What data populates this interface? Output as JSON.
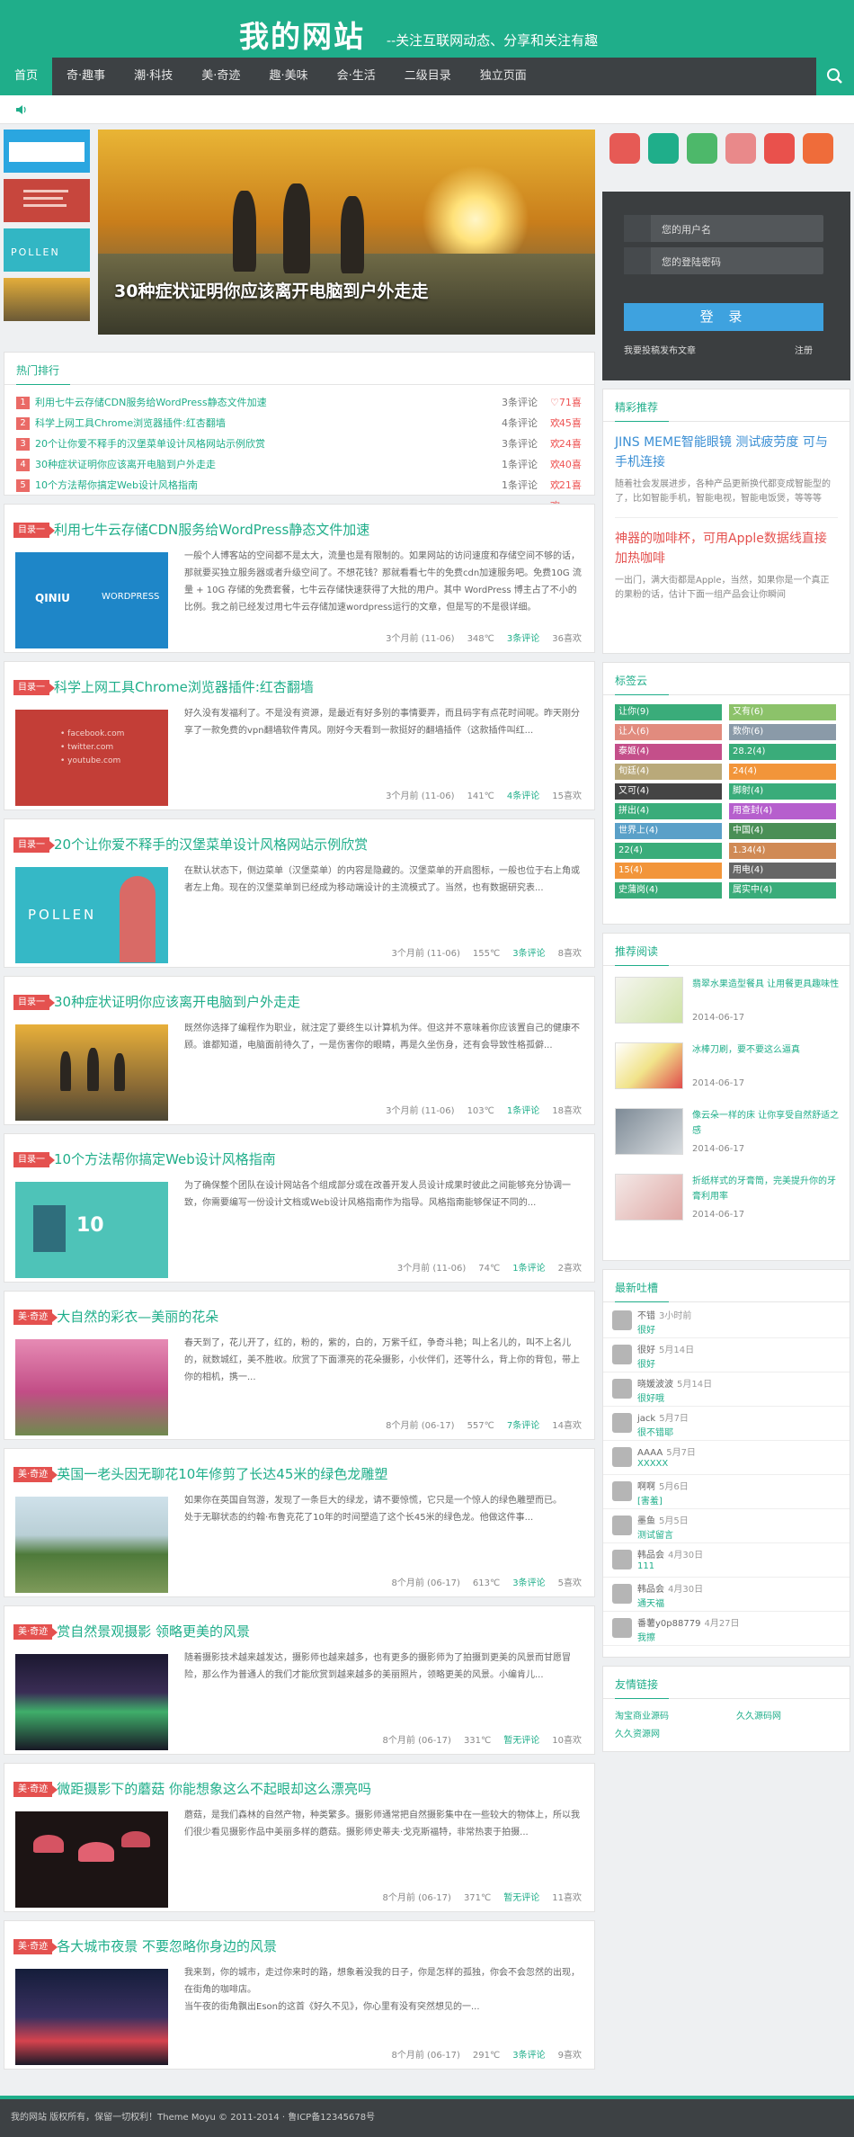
{
  "header": {
    "logo": "我的网站",
    "slogan": "--关注互联网动态、分享和关注有趣"
  },
  "nav": {
    "items": [
      "首页",
      "奇·趣事",
      "潮·科技",
      "美·奇迹",
      "趣·美味",
      "会·生活",
      "二级目录",
      "独立页面"
    ]
  },
  "slider": {
    "caption": "30种症状证明你应该离开电脑到户外走走"
  },
  "hot": {
    "title": "热门排行",
    "items": [
      {
        "num": "1",
        "title": "利用七牛云存储CDN服务给WordPress静态文件加速",
        "comments": "3条评论",
        "likes": "♡71喜欢"
      },
      {
        "num": "2",
        "title": "科学上网工具Chrome浏览器插件:红杏翻墙",
        "comments": "4条评论",
        "likes": "♡45喜欢"
      },
      {
        "num": "3",
        "title": "20个让你爱不释手的汉堡菜单设计风格网站示例欣赏",
        "comments": "3条评论",
        "likes": "♡24喜欢"
      },
      {
        "num": "4",
        "title": "30种症状证明你应该离开电脑到户外走走",
        "comments": "1条评论",
        "likes": "♡40喜欢"
      },
      {
        "num": "5",
        "title": "10个方法帮你搞定Web设计风格指南",
        "comments": "1条评论",
        "likes": "♡21喜欢"
      }
    ]
  },
  "posts": [
    {
      "badge": "目录一",
      "title": "利用七牛云存储CDN服务给WordPress静态文件加速",
      "excerpt": "一般个人博客站的空间都不是太大，流量也是有限制的。如果网站的访问速度和存储空间不够的话，那就要买独立服务器或者升级空间了。不想花钱？那就看看七牛的免费cdn加速服务吧。免费10G 流量 + 10G 存储的免费套餐，七牛云存储快速获得了大批的用户。其中 WordPress 博主占了不小的比例。我之前已经发过用七牛云存储加速wordpress运行的文章，但是写的不是很详细。",
      "time": "3个月前 (11-06)",
      "views": "348℃",
      "comments": "3条评论",
      "likes": "36喜欢"
    },
    {
      "badge": "目录一",
      "title": "科学上网工具Chrome浏览器插件:红杏翻墙",
      "excerpt": "好久没有发福利了。不是没有资源，是最近有好多别的事情要弄，而且码字有点花时间呢。昨天刚分享了一款免费的vpn翻墙软件青风。刚好今天看到一款挺好的翻墙插件（这款插件叫红...",
      "time": "3个月前 (11-06)",
      "views": "141℃",
      "comments": "4条评论",
      "likes": "15喜欢"
    },
    {
      "badge": "目录一",
      "title": "20个让你爱不释手的汉堡菜单设计风格网站示例欣赏",
      "excerpt": "在默认状态下，侧边菜单（汉堡菜单）的内容是隐藏的。汉堡菜单的开启图标，一般也位于右上角或者左上角。现在的汉堡菜单到已经成为移动端设计的主流模式了。当然，也有数据研究表...",
      "time": "3个月前 (11-06)",
      "views": "155℃",
      "comments": "3条评论",
      "likes": "8喜欢"
    },
    {
      "badge": "目录一",
      "title": "30种症状证明你应该离开电脑到户外走走",
      "excerpt": "既然你选择了编程作为职业，就注定了要终生以计算机为伴。但这并不意味着你应该置自己的健康不顾。谁都知道，电脑面前待久了，一是伤害你的眼睛，再是久坐伤身，还有会导致性格孤僻...",
      "time": "3个月前 (11-06)",
      "views": "103℃",
      "comments": "1条评论",
      "likes": "18喜欢"
    },
    {
      "badge": "目录一",
      "title": "10个方法帮你搞定Web设计风格指南",
      "excerpt": "为了确保整个团队在设计网站各个组成部分或在改善开发人员设计成果时彼此之间能够充分协调一致，你需要编写一份设计文档或Web设计风格指南作为指导。风格指南能够保证不同的...",
      "time": "3个月前 (11-06)",
      "views": "74℃",
      "comments": "1条评论",
      "likes": "2喜欢"
    },
    {
      "badge": "美·奇迹",
      "title": "大自然的彩衣—美丽的花朵",
      "excerpt": "春天到了，花儿开了，红的，粉的，紫的，白的，万紫千红，争奇斗艳；叫上名儿的，叫不上名儿的，就数城红，美不胜收。欣赏了下面漂亮的花朵摄影，小伙伴们，还等什么，背上你的背包，带上你的相机，携一...",
      "time": "8个月前 (06-17)",
      "views": "557℃",
      "comments": "7条评论",
      "likes": "14喜欢"
    },
    {
      "badge": "美·奇迹",
      "title": "英国一老头因无聊花10年修剪了长达45米的绿色龙雕塑",
      "excerpt": "如果你在英国自驾游，发现了一条巨大的绿龙，请不要惊慌，它只是一个惊人的绿色雕塑而已。\n处于无聊状态的约翰·布鲁克花了10年的时间塑造了这个长45米的绿色龙。他做这件事...",
      "time": "8个月前 (06-17)",
      "views": "613℃",
      "comments": "3条评论",
      "likes": "5喜欢"
    },
    {
      "badge": "美·奇迹",
      "title": "赏自然景观摄影 领略更美的风景",
      "excerpt": "随着摄影技术越来越发达，摄影师也越来越多，也有更多的摄影师为了拍摄到更美的风景而甘愿冒险，那么作为普通人的我们才能欣赏到越来越多的美丽照片，领略更美的风景。小编肯儿...",
      "time": "8个月前 (06-17)",
      "views": "331℃",
      "comments": "暂无评论",
      "likes": "10喜欢"
    },
    {
      "badge": "美·奇迹",
      "title": "微距摄影下的蘑菇 你能想象这么不起眼却这么漂亮吗",
      "excerpt": "蘑菇，是我们森林的自然产物，种类繁多。摄影师通常把自然摄影集中在一些较大的物体上，所以我们很少看见摄影作品中美丽多样的蘑菇。摄影师史蒂夫·戈克斯福特，非常热衷于拍摄...",
      "time": "8个月前 (06-17)",
      "views": "371℃",
      "comments": "暂无评论",
      "likes": "11喜欢"
    },
    {
      "badge": "美·奇迹",
      "title": "各大城市夜景 不要忽略你身边的风景",
      "excerpt": "我来到，你的城市，走过你来时的路，想象着没我的日子，你是怎样的孤独，你会不会忽然的出现，在街角的咖啡店。\n当午夜的街角飘出Eson的这首《好久不见》，你心里有没有突然想见的一...",
      "time": "8个月前 (06-17)",
      "views": "291℃",
      "comments": "3条评论",
      "likes": "9喜欢"
    }
  ],
  "login": {
    "username_placeholder": "您的用户名",
    "password_placeholder": "您的登陆密码",
    "button": "登 录",
    "post_link": "我要投稿发布文章",
    "register": "注册"
  },
  "featured": {
    "title": "精彩推荐",
    "items": [
      {
        "title": "JINS MEME智能眼镜 测试疲劳度 可与手机连接",
        "desc": "随着社会发展进步，各种产品更新换代都变成智能型的了，比如智能手机，智能电视，智能电饭煲，等等等",
        "color": "#3b8fd4"
      },
      {
        "title": "神器的咖啡杯，可用Apple数据线直接加热咖啡",
        "desc": "一出门，满大街都是Apple，当然，如果你是一个真正的果粉的话，估计下面一组产品会让你瞬间",
        "color": "#e4514f"
      }
    ]
  },
  "tagcloud": {
    "title": "标签云",
    "tags": [
      {
        "label": "让你(9)",
        "color": "#3aac7a"
      },
      {
        "label": "又有(6)",
        "color": "#8cc26a"
      },
      {
        "label": "让人(6)",
        "color": "#e18b7e"
      },
      {
        "label": "数你(6)",
        "color": "#8a9aa8"
      },
      {
        "label": "泰姬(4)",
        "color": "#c44f8a"
      },
      {
        "label": "28.2(4)",
        "color": "#3aac7a"
      },
      {
        "label": "旬廷(4)",
        "color": "#b9a97a"
      },
      {
        "label": "24(4)",
        "color": "#f2953a"
      },
      {
        "label": "又可(4)",
        "color": "#444444"
      },
      {
        "label": "脚射(4)",
        "color": "#3aac7a"
      },
      {
        "label": "拼出(4)",
        "color": "#3aac7a"
      },
      {
        "label": "用查封(4)",
        "color": "#b65fcd"
      },
      {
        "label": "世界上(4)",
        "color": "#5aa0c8"
      },
      {
        "label": "中国(4)",
        "color": "#4a8f56"
      },
      {
        "label": "22(4)",
        "color": "#3aac7a"
      },
      {
        "label": "1.34(4)",
        "color": "#d08a55"
      },
      {
        "label": "15(4)",
        "color": "#f2953a"
      },
      {
        "label": "用电(4)",
        "color": "#666666"
      },
      {
        "label": "史蒲岗(4)",
        "color": "#3aac7a"
      },
      {
        "label": "属实中(4)",
        "color": "#3aac7a"
      }
    ]
  },
  "reading": {
    "title": "推荐阅读",
    "items": [
      {
        "title": "翡翠水果造型餐具 让用餐更具趣味性",
        "date": "2014-06-17"
      },
      {
        "title": "冰棒刀刷，要不要这么逼真",
        "date": "2014-06-17"
      },
      {
        "title": "像云朵一样的床 让你享受自然舒适之感",
        "date": "2014-06-17"
      },
      {
        "title": "折纸样式的牙膏筒，完美提升你的牙膏利用率",
        "date": "2014-06-17"
      }
    ]
  },
  "comments": {
    "title": "最新吐槽",
    "items": [
      {
        "name": "不错",
        "time": "3小时前",
        "text": "很好"
      },
      {
        "name": "很好",
        "time": "5月14日",
        "text": "很好"
      },
      {
        "name": "晓媛波波",
        "time": "5月14日",
        "text": "很好哦"
      },
      {
        "name": "jack",
        "time": "5月7日",
        "text": "很不错耶"
      },
      {
        "name": "AAAA",
        "time": "5月7日",
        "text": "XXXXX"
      },
      {
        "name": "啊啊",
        "time": "5月6日",
        "text": "[害羞]"
      },
      {
        "name": "墨鱼",
        "time": "5月5日",
        "text": "测试留言"
      },
      {
        "name": "韩品会",
        "time": "4月30日",
        "text": "111"
      },
      {
        "name": "韩品会",
        "time": "4月30日",
        "text": "通天福"
      },
      {
        "name": "番薯y0p88779",
        "time": "4月27日",
        "text": "我擦"
      }
    ]
  },
  "links": {
    "title": "友情链接",
    "items": [
      "淘宝商业源码",
      "久久源码网",
      "久久资源网"
    ]
  },
  "footer": {
    "text": "我的网站 版权所有，保留一切权利！Theme Moyu © 2011-2014 · 鲁ICP备12345678号"
  }
}
